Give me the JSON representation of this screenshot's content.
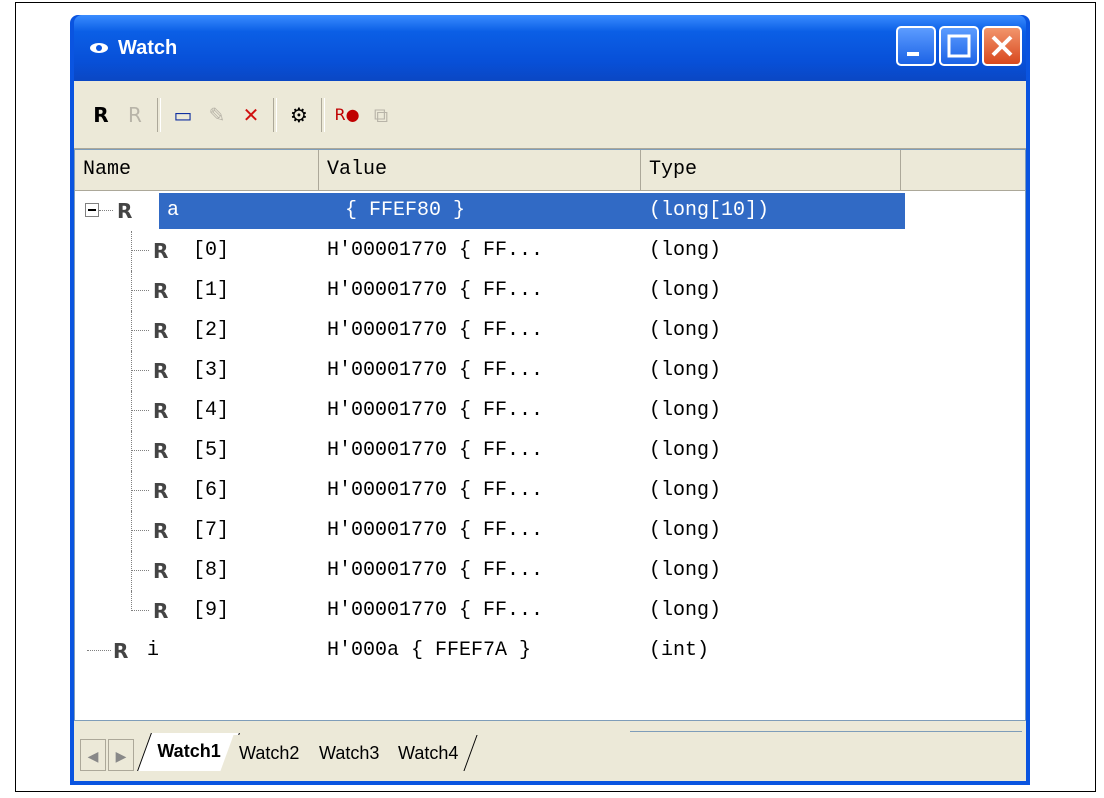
{
  "window": {
    "title": "Watch"
  },
  "toolbar": {
    "buttons": [
      {
        "name": "r-button",
        "glyph": "R",
        "disabled": false
      },
      {
        "name": "r-disabled-button",
        "glyph": "R",
        "disabled": true
      },
      {
        "name": "add-watch-button",
        "glyph": "▭",
        "disabled": false
      },
      {
        "name": "edit-button",
        "glyph": "✎",
        "disabled": true
      },
      {
        "name": "delete-button",
        "glyph": "✕",
        "disabled": false
      },
      {
        "name": "settings-button",
        "glyph": "⚙",
        "disabled": false
      },
      {
        "name": "record-button",
        "glyph": "R●",
        "disabled": false
      },
      {
        "name": "copy-button",
        "glyph": "⧉",
        "disabled": true
      }
    ]
  },
  "columns": {
    "name": "Name",
    "value": "Value",
    "type": "Type"
  },
  "rows": [
    {
      "name": "a",
      "value": "{ FFEF80 }",
      "type": "(long[10])"
    },
    {
      "name": "[0]",
      "value": "H'00001770 { FF...",
      "type": "(long)"
    },
    {
      "name": "[1]",
      "value": "H'00001770 { FF...",
      "type": "(long)"
    },
    {
      "name": "[2]",
      "value": "H'00001770 { FF...",
      "type": "(long)"
    },
    {
      "name": "[3]",
      "value": "H'00001770 { FF...",
      "type": "(long)"
    },
    {
      "name": "[4]",
      "value": "H'00001770 { FF...",
      "type": "(long)"
    },
    {
      "name": "[5]",
      "value": "H'00001770 { FF...",
      "type": "(long)"
    },
    {
      "name": "[6]",
      "value": "H'00001770 { FF...",
      "type": "(long)"
    },
    {
      "name": "[7]",
      "value": "H'00001770 { FF...",
      "type": "(long)"
    },
    {
      "name": "[8]",
      "value": "H'00001770 { FF...",
      "type": "(long)"
    },
    {
      "name": "[9]",
      "value": "H'00001770 { FF...",
      "type": "(long)"
    },
    {
      "name": "i",
      "value": "H'000a { FFEF7A }",
      "type": "(int)"
    }
  ],
  "tabs": [
    "Watch1",
    "Watch2",
    "Watch3",
    "Watch4"
  ],
  "colors": {
    "titlebar": "#0a54e0",
    "selection": "#316ac5",
    "face": "#ece9d8"
  }
}
